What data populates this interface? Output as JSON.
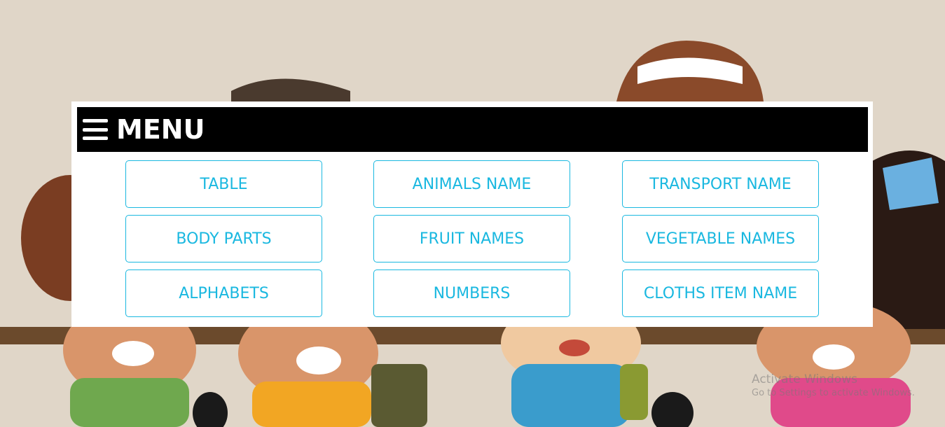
{
  "menu": {
    "title": "MENU",
    "hamburger_icon": "hamburger-menu-icon"
  },
  "buttons": [
    {
      "label": "TABLE"
    },
    {
      "label": "ANIMALS NAME"
    },
    {
      "label": "TRANSPORT NAME"
    },
    {
      "label": "BODY PARTS"
    },
    {
      "label": "FRUIT NAMES"
    },
    {
      "label": "VEGETABLE NAMES"
    },
    {
      "label": "ALPHABETS"
    },
    {
      "label": "NUMBERS"
    },
    {
      "label": "CLOTHS ITEM NAME"
    }
  ],
  "watermark": {
    "title": "Activate Windows",
    "subtitle": "Go to Settings to activate Windows."
  },
  "colors": {
    "accent": "#1ab8e0",
    "header_bg": "#000000",
    "panel_bg": "#ffffff"
  }
}
